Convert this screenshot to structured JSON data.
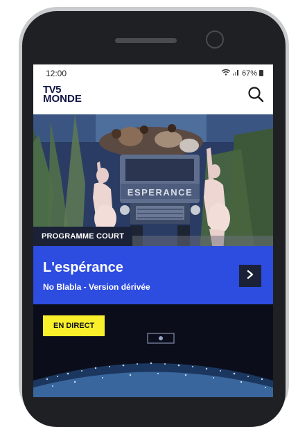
{
  "status": {
    "time": "12:00",
    "battery": "67%"
  },
  "app": {
    "logo_line1": "TV5",
    "logo_line2": "MONDE"
  },
  "hero": {
    "truck_label": "ESPERANCE"
  },
  "featured": {
    "category": "PROGRAMME COURT",
    "title": "L'espérance",
    "subtitle": "No Blabla - Version dérivée"
  },
  "live": {
    "label": "EN DIRECT"
  },
  "colors": {
    "accent": "#2d4ce0",
    "navy": "#1b2237",
    "live_yellow": "#f9ef2b"
  }
}
